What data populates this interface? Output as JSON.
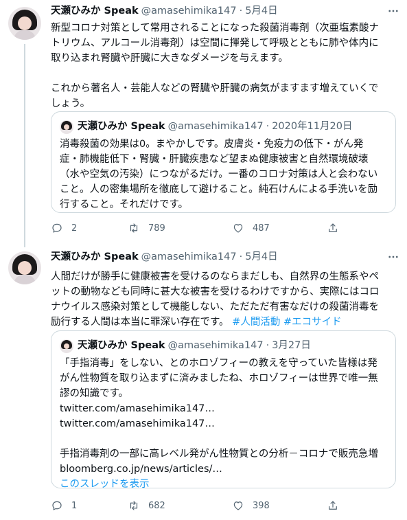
{
  "tweets": [
    {
      "display_name": "天瀬ひみか Speak",
      "handle": "@amasehimika147",
      "separator": "·",
      "date": "5月4日",
      "body_lines": [
        "新型コロナ対策として常用されることになった殺菌消毒剤（次亜塩素酸ナ",
        "トリウム、アルコール消毒剤）は空間に揮発して呼吸とともに肺や体内に",
        "取り込まれ腎臓や肝臓に大きなダメージを与えます。",
        "",
        "これから著名人・芸能人などの腎臓や肝臓の病気がますます増えていくで",
        "しょう。"
      ],
      "quote": {
        "display_name": "天瀬ひみか Speak",
        "handle": "@amasehimika147",
        "separator": "·",
        "date": "2020年11月20日",
        "lines": [
          "消毒殺菌の効果は0。まやかしです。皮膚炎・免疫力の低下・がん発",
          "症・肺機能低下・腎臓・肝臓疾患など望まぬ健康被害と自然環境破壊",
          "（水や空気の汚染）につながるだけ。一番のコロナ対策は人と会わない",
          "こと。人の密集場所を徹底して避けること。純石けんによる手洗いを励",
          "行すること。それだけです。"
        ]
      },
      "counts": {
        "replies": "2",
        "retweets": "789",
        "likes": "487"
      }
    },
    {
      "display_name": "天瀬ひみか Speak",
      "handle": "@amasehimika147",
      "separator": "·",
      "date": "5月4日",
      "body_lines": [
        "人間だけが勝手に健康被害を受けるのならまだしも、自然界の生態系やペ",
        "ットの動物なども同時に甚大な被害を受けるわけですから、実際にはコロ",
        "ナウイルス感染対策として機能しない、ただただ有害なだけの殺菌消毒を",
        "励行する人間は本当に罪深い存在です。"
      ],
      "hashtags": [
        "#人間活動",
        "#エコサイド"
      ],
      "quote": {
        "display_name": "天瀬ひみか Speak",
        "handle": "@amasehimika147",
        "separator": "·",
        "date": "3月27日",
        "lines": [
          "「手指消毒」をしない、とのホロゾフィーの教えを守っていた皆様は発",
          "がん性物質を取り込まずに済みましたね、ホロゾフィーは世界で唯一無",
          "謬の知識です。",
          "twitter.com/amasehimika147…",
          "twitter.com/amasehimika147…",
          "",
          "手指消毒剤の一部に高レベル発がん性物質との分析－コロナで販売急増",
          "bloomberg.co.jp/news/articles/…"
        ],
        "show_thread": "このスレッドを表示"
      },
      "counts": {
        "replies": "1",
        "retweets": "682",
        "likes": "398"
      }
    }
  ],
  "colors": {
    "link": "#1d9bf0",
    "secondary_text": "#536471",
    "border": "#cfd9de",
    "text": "#0f1419"
  },
  "icons": [
    "more-icon",
    "reply-icon",
    "retweet-icon",
    "like-icon",
    "share-icon"
  ]
}
